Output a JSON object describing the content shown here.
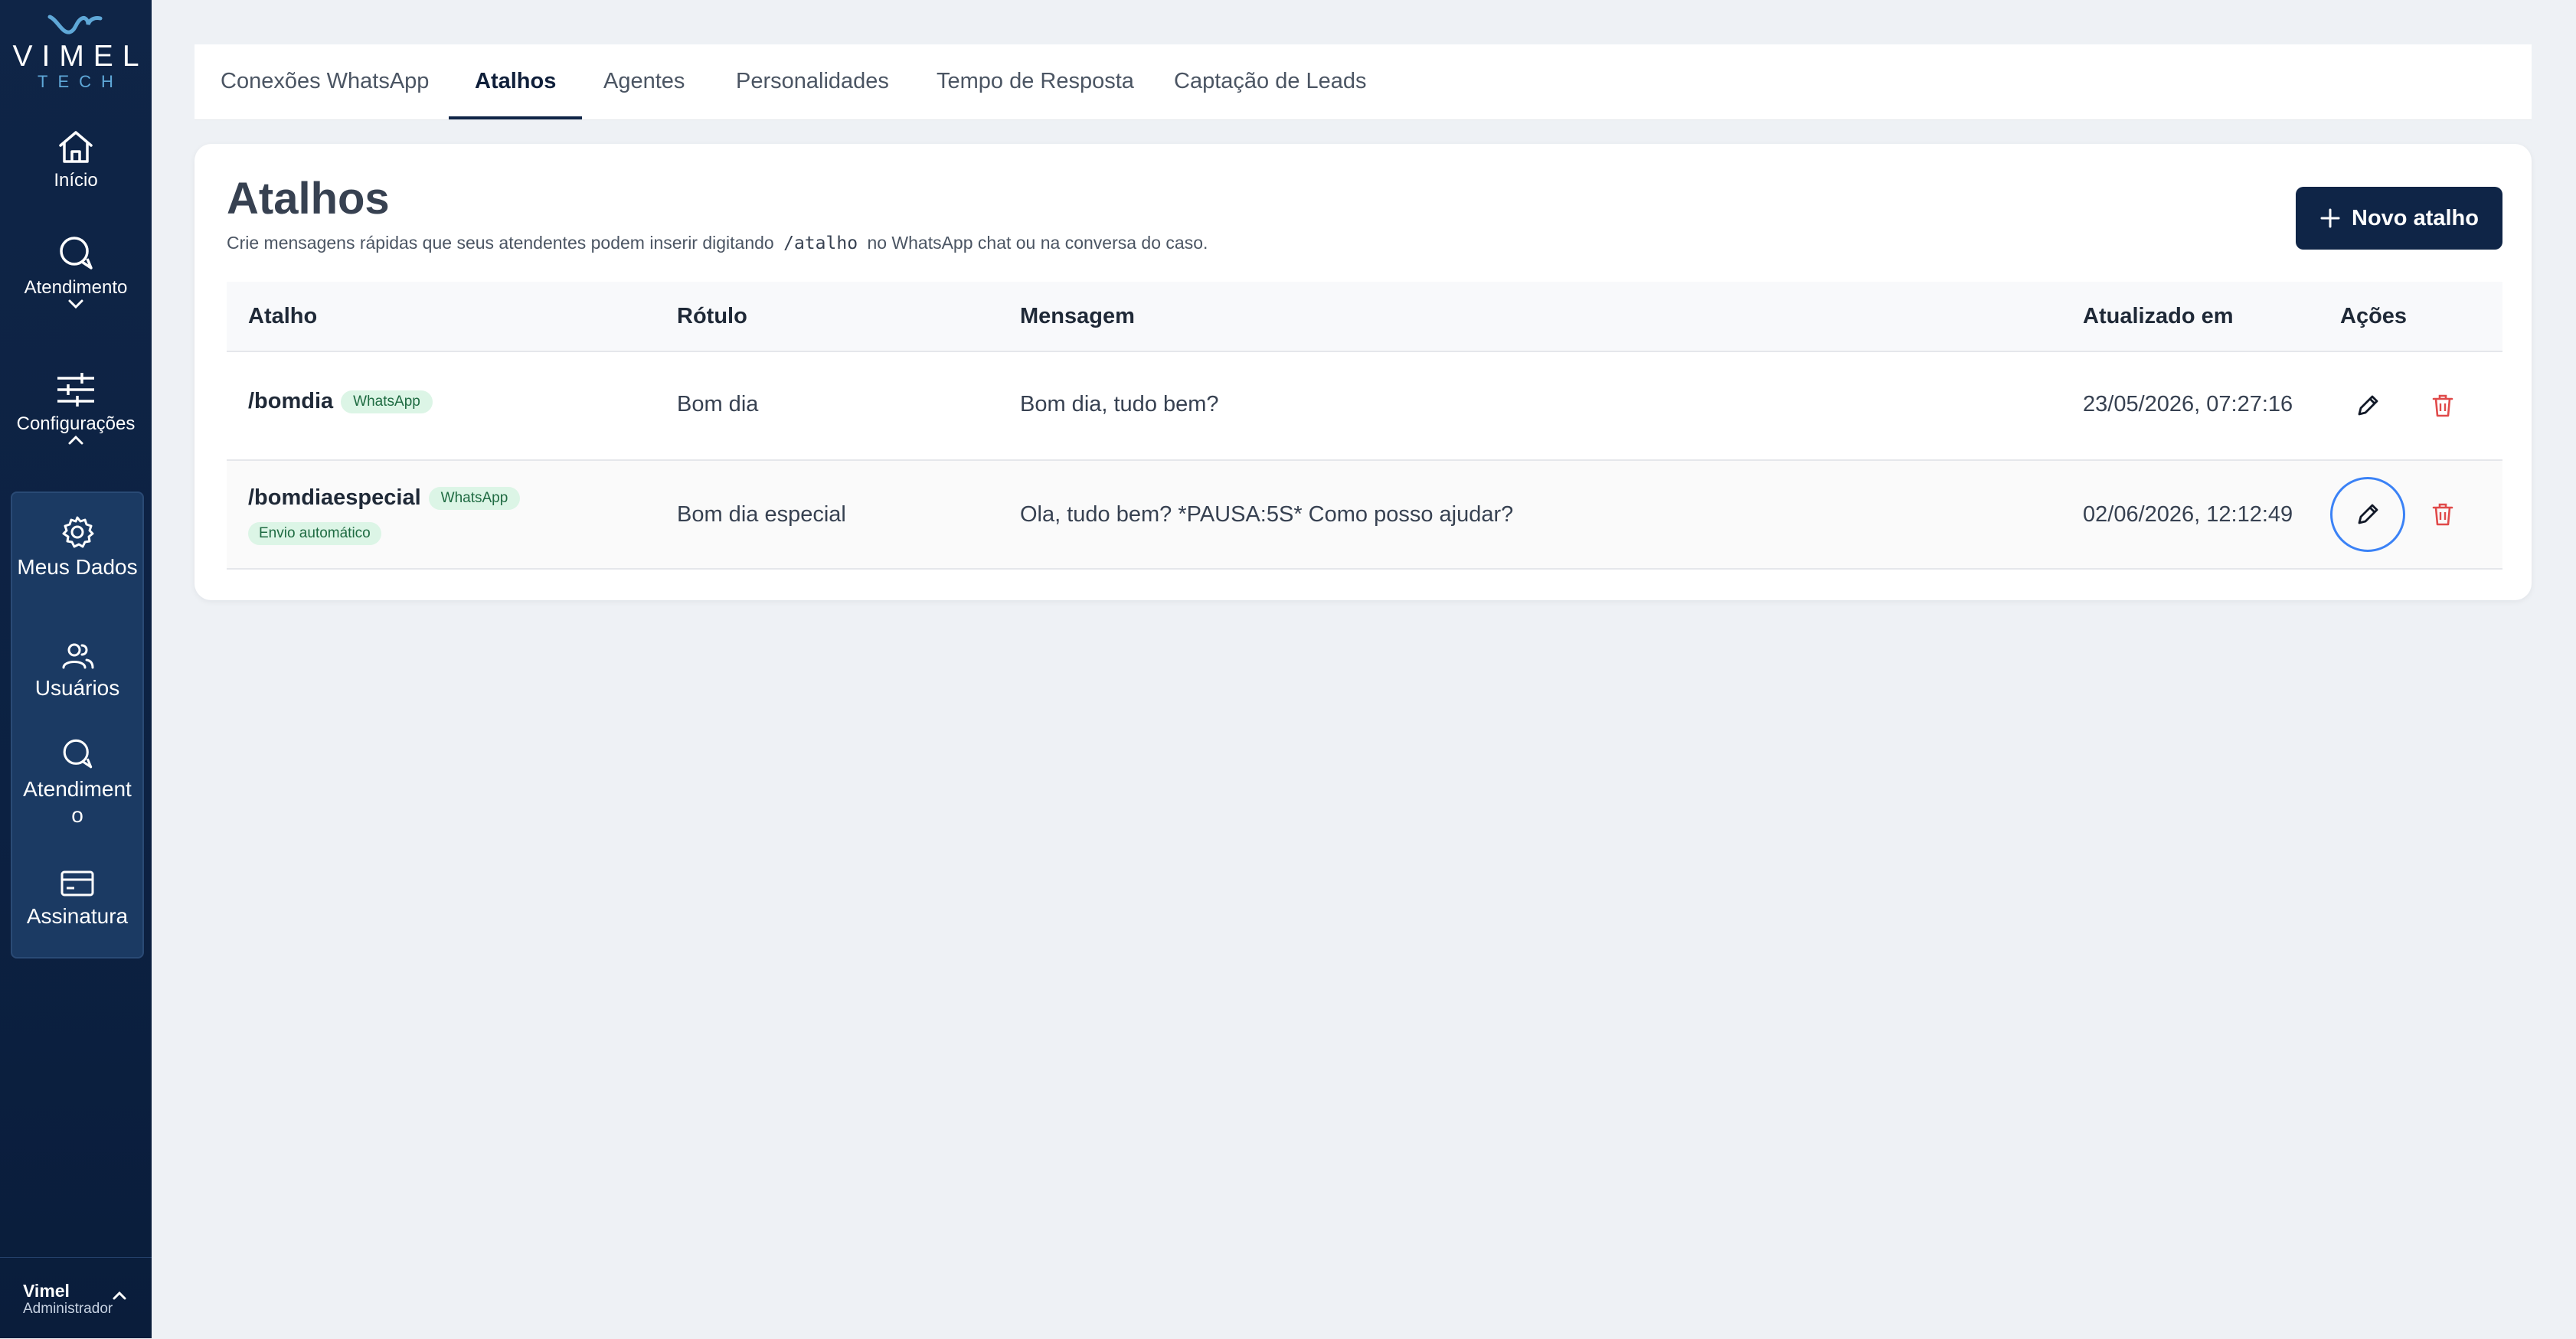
{
  "brand": {
    "name": "VIMEL",
    "sub": "TECH"
  },
  "sidebar": {
    "nav": [
      {
        "label": "Início",
        "icon": "home-icon"
      },
      {
        "label": "Atendimento",
        "icon": "chat-icon"
      },
      {
        "label": "Configurações",
        "icon": "sliders-icon"
      }
    ],
    "sub": [
      {
        "label": "Meus Dados",
        "icon": "gear-icon"
      },
      {
        "label": "Usuários",
        "icon": "users-icon"
      },
      {
        "label": "Atendimento",
        "icon": "chat-icon"
      },
      {
        "label": "Assinatura",
        "icon": "card-icon"
      }
    ],
    "user": {
      "name": "Vimel",
      "role": "Administrador"
    }
  },
  "tabs": [
    {
      "label": "Conexões WhatsApp"
    },
    {
      "label": "Atalhos",
      "active": true
    },
    {
      "label": "Agentes"
    },
    {
      "label": "Personalidades"
    },
    {
      "label": "Tempo de Resposta"
    },
    {
      "label": "Captação de Leads"
    }
  ],
  "page": {
    "title": "Atalhos",
    "desc_before": "Crie mensagens rápidas que seus atendentes podem inserir digitando",
    "desc_code": "/atalho",
    "desc_after": "no WhatsApp chat ou na conversa do caso.",
    "new_button": "Novo atalho"
  },
  "table": {
    "headers": [
      "Atalho",
      "Rótulo",
      "Mensagem",
      "Atualizado em",
      "Ações"
    ],
    "rows": [
      {
        "shortcut": "/bomdia",
        "channel": "WhatsApp",
        "label": "Bom dia",
        "message": "Bom dia, tudo bem?",
        "updated": "23/05/2026, 07:27:16"
      },
      {
        "shortcut": "/bomdiaespecial",
        "channel": "WhatsApp",
        "auto": "Envio automático",
        "label": "Bom dia especial",
        "message": "Ola, tudo bem? *PAUSA:5S* Como posso ajudar?",
        "updated": "02/06/2026, 12:12:49"
      }
    ]
  },
  "colors": {
    "primary": "#0f2547",
    "accent": "#3b82f6",
    "danger": "#e04a4a",
    "badge_bg": "#dcf5e6"
  }
}
